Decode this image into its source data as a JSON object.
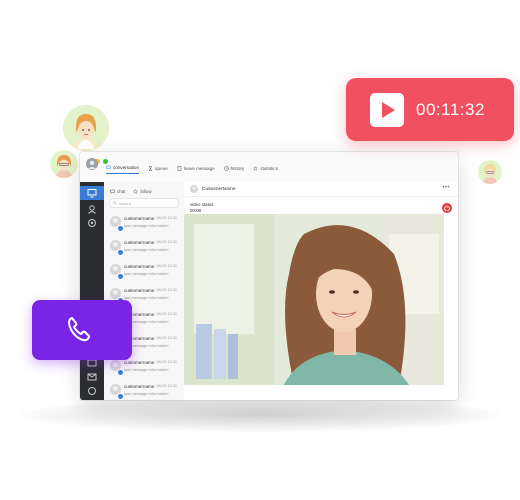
{
  "colors": {
    "recording_card": "#f0505f",
    "call_card": "#7a25e6",
    "rail": "#2b2d31",
    "accent": "#3a7bd5",
    "end_call": "#e03a3a"
  },
  "recording": {
    "time": "00:11:32",
    "icon": "play-icon"
  },
  "call_card": {
    "icon": "phone-icon"
  },
  "window": {
    "tabs": [
      {
        "label": "conversation",
        "icon": "chat-icon"
      },
      {
        "label": "queue",
        "icon": "hourglass-icon"
      },
      {
        "label": "leave message",
        "icon": "document-icon"
      },
      {
        "label": "history",
        "icon": "clock-icon"
      },
      {
        "label": "statistics",
        "icon": "star-icon"
      }
    ],
    "list": {
      "tabs": [
        {
          "label": "chat",
          "icon": "chat-icon"
        },
        {
          "label": "follow",
          "icon": "star-icon"
        }
      ],
      "search_placeholder": "search",
      "items": [
        {
          "name": "customername",
          "time": "05-03 12:31",
          "message": "last message information"
        },
        {
          "name": "customername",
          "time": "05-03 12:31",
          "message": "last message information"
        },
        {
          "name": "customername",
          "time": "05-03 12:31",
          "message": "last message information"
        },
        {
          "name": "customername",
          "time": "05-03 12:31",
          "message": "last message information"
        },
        {
          "name": "customername",
          "time": "05-03 12:31",
          "message": "last message information"
        },
        {
          "name": "customername",
          "time": "05-03 12:31",
          "message": "last message information"
        },
        {
          "name": "customername",
          "time": "05-03 12:31",
          "message": "last message information"
        },
        {
          "name": "customername",
          "time": "05-03 12:31",
          "message": "last message information"
        },
        {
          "name": "customername",
          "time": "05-03 12:31",
          "message": "last message information"
        }
      ]
    },
    "chat": {
      "customer_name": "CustomerName",
      "more": "•••",
      "status_label": "video status",
      "status_time": "00:08"
    }
  }
}
